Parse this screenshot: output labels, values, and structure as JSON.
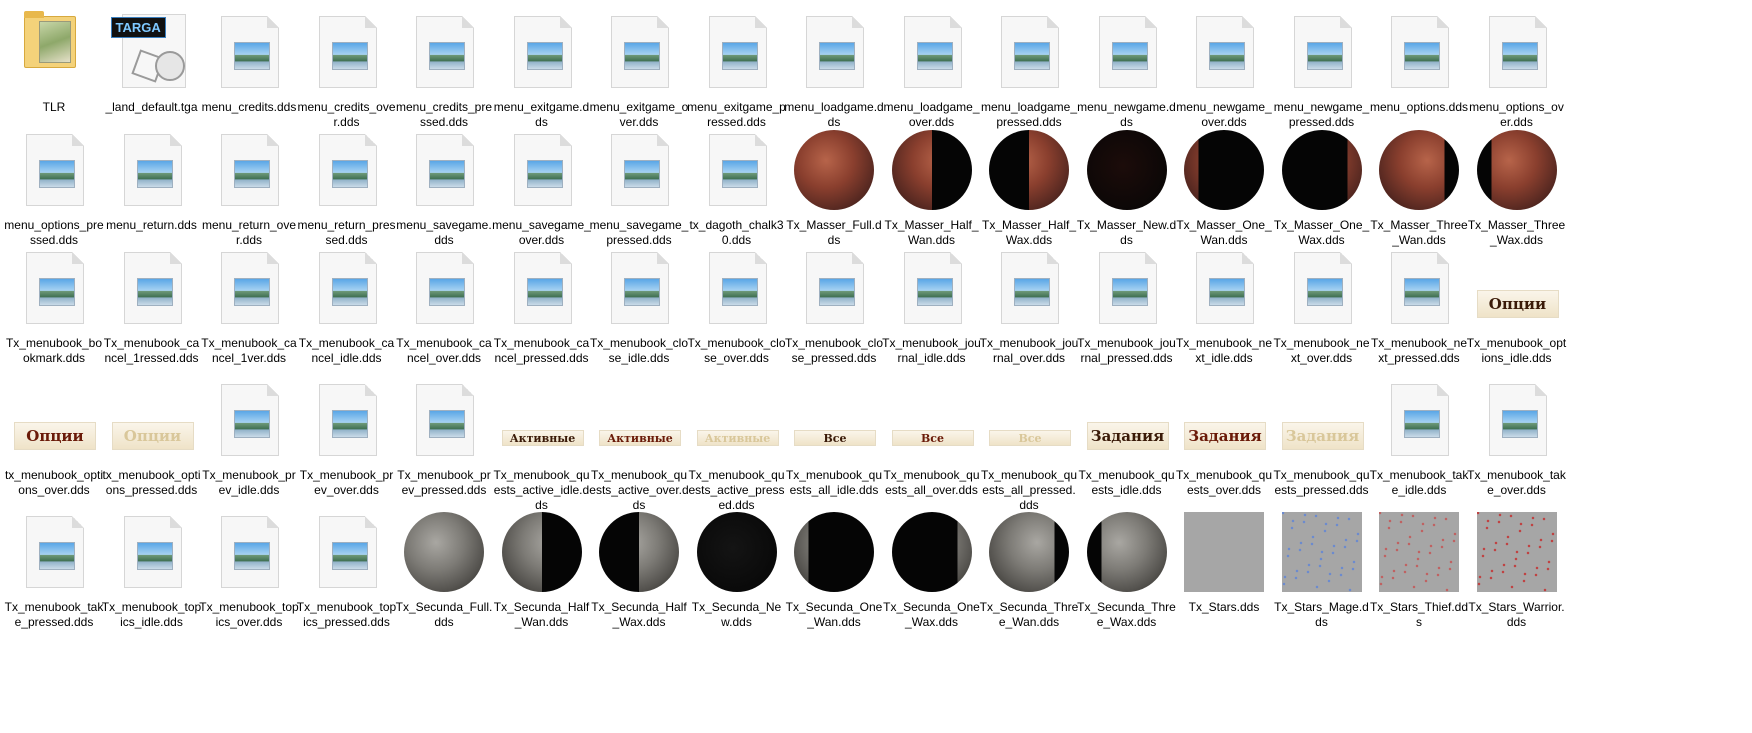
{
  "files": [
    {
      "label": "TLR",
      "kind": "folder"
    },
    {
      "label": "_land_default.tga",
      "kind": "tga",
      "badge": "TARGA"
    },
    {
      "label": "menu_credits.dds",
      "kind": "doc"
    },
    {
      "label": "menu_credits_over.dds",
      "kind": "doc"
    },
    {
      "label": "menu_credits_pressed.dds",
      "kind": "doc"
    },
    {
      "label": "menu_exitgame.dds",
      "kind": "doc"
    },
    {
      "label": "menu_exitgame_over.dds",
      "kind": "doc"
    },
    {
      "label": "menu_exitgame_pressed.dds",
      "kind": "doc"
    },
    {
      "label": "menu_loadgame.dds",
      "kind": "doc"
    },
    {
      "label": "menu_loadgame_over.dds",
      "kind": "doc"
    },
    {
      "label": "menu_loadgame_pressed.dds",
      "kind": "doc"
    },
    {
      "label": "menu_newgame.dds",
      "kind": "doc"
    },
    {
      "label": "menu_newgame_over.dds",
      "kind": "doc"
    },
    {
      "label": "menu_newgame_pressed.dds",
      "kind": "doc"
    },
    {
      "label": "menu_options.dds",
      "kind": "doc"
    },
    {
      "label": "menu_options_over.dds",
      "kind": "doc"
    },
    {
      "label": "menu_options_pressed.dds",
      "kind": "doc"
    },
    {
      "label": "menu_return.dds",
      "kind": "doc"
    },
    {
      "label": "menu_return_over.dds",
      "kind": "doc"
    },
    {
      "label": "menu_return_pressed.dds",
      "kind": "doc"
    },
    {
      "label": "menu_savegame.dds",
      "kind": "doc"
    },
    {
      "label": "menu_savegame_over.dds",
      "kind": "doc"
    },
    {
      "label": "menu_savegame_pressed.dds",
      "kind": "doc"
    },
    {
      "label": "tx_dagoth_chalk30.dds",
      "kind": "doc"
    },
    {
      "label": "Tx_Masser_Full.dds",
      "kind": "moon",
      "moon": "masser",
      "phase": "full"
    },
    {
      "label": "Tx_Masser_Half_Wan.dds",
      "kind": "moon",
      "moon": "masser",
      "phase": "half-wan"
    },
    {
      "label": "Tx_Masser_Half_Wax.dds",
      "kind": "moon",
      "moon": "masser",
      "phase": "half-wax"
    },
    {
      "label": "Tx_Masser_New.dds",
      "kind": "moon",
      "moon": "masser",
      "phase": "new"
    },
    {
      "label": "Tx_Masser_One_Wan.dds",
      "kind": "moon",
      "moon": "masser",
      "phase": "one-wan"
    },
    {
      "label": "Tx_Masser_One_Wax.dds",
      "kind": "moon",
      "moon": "masser",
      "phase": "one-wax"
    },
    {
      "label": "Tx_Masser_Three_Wan.dds",
      "kind": "moon",
      "moon": "masser",
      "phase": "three-wan"
    },
    {
      "label": "Tx_Masser_Three_Wax.dds",
      "kind": "moon",
      "moon": "masser",
      "phase": "three-wax"
    },
    {
      "label": "Tx_menubook_bookmark.dds",
      "kind": "doc"
    },
    {
      "label": "Tx_menubook_cancel_1ressed.dds",
      "kind": "doc"
    },
    {
      "label": "Tx_menubook_cancel_1ver.dds",
      "kind": "doc"
    },
    {
      "label": "Tx_menubook_cancel_idle.dds",
      "kind": "doc"
    },
    {
      "label": "Tx_menubook_cancel_over.dds",
      "kind": "doc"
    },
    {
      "label": "Tx_menubook_cancel_pressed.dds",
      "kind": "doc"
    },
    {
      "label": "Tx_menubook_close_idle.dds",
      "kind": "doc"
    },
    {
      "label": "Tx_menubook_close_over.dds",
      "kind": "doc"
    },
    {
      "label": "Tx_menubook_close_pressed.dds",
      "kind": "doc"
    },
    {
      "label": "Tx_menubook_journal_idle.dds",
      "kind": "doc"
    },
    {
      "label": "Tx_menubook_journal_over.dds",
      "kind": "doc"
    },
    {
      "label": "Tx_menubook_journal_pressed.dds",
      "kind": "doc"
    },
    {
      "label": "Tx_menubook_next_idle.dds",
      "kind": "doc"
    },
    {
      "label": "Tx_menubook_next_over.dds",
      "kind": "doc"
    },
    {
      "label": "Tx_menubook_next_pressed.dds",
      "kind": "doc"
    },
    {
      "label": "Tx_menubook_options_idle.dds",
      "kind": "btn",
      "text": "Опции",
      "color": "#3a1a08"
    },
    {
      "label": "tx_menubook_options_over.dds",
      "kind": "btn",
      "text": "Опции",
      "color": "#6a1a08"
    },
    {
      "label": "tx_menubook_options_pressed.dds",
      "kind": "btn",
      "text": "Опции",
      "color": "#d9c79a"
    },
    {
      "label": "Tx_menubook_prev_idle.dds",
      "kind": "doc"
    },
    {
      "label": "Tx_menubook_prev_over.dds",
      "kind": "doc"
    },
    {
      "label": "Tx_menubook_prev_pressed.dds",
      "kind": "doc"
    },
    {
      "label": "Tx_menubook_quests_active_idle.dds",
      "kind": "btnsmall",
      "text": "Активные",
      "color": "#3a1a08"
    },
    {
      "label": "Tx_menubook_quests_active_over.dds",
      "kind": "btnsmall",
      "text": "Активные",
      "color": "#6a1a08"
    },
    {
      "label": "Tx_menubook_quests_active_pressed.dds",
      "kind": "btnsmall",
      "text": "Активные",
      "color": "#d9c79a"
    },
    {
      "label": "Tx_menubook_quests_all_idle.dds",
      "kind": "btnsmall",
      "text": "Все",
      "color": "#3a1a08"
    },
    {
      "label": "Tx_menubook_quests_all_over.dds",
      "kind": "btnsmall",
      "text": "Все",
      "color": "#6a1a08"
    },
    {
      "label": "Tx_menubook_quests_all_pressed.dds",
      "kind": "btnsmall",
      "text": "Все",
      "color": "#d9c79a"
    },
    {
      "label": "Tx_menubook_quests_idle.dds",
      "kind": "btn",
      "text": "Задания",
      "color": "#3a1a08"
    },
    {
      "label": "Tx_menubook_quests_over.dds",
      "kind": "btn",
      "text": "Задания",
      "color": "#6a1a08"
    },
    {
      "label": "Tx_menubook_quests_pressed.dds",
      "kind": "btn",
      "text": "Задания",
      "color": "#d9c79a"
    },
    {
      "label": "Tx_menubook_take_idle.dds",
      "kind": "doc"
    },
    {
      "label": "Tx_menubook_take_over.dds",
      "kind": "doc"
    },
    {
      "label": "Tx_menubook_take_pressed.dds",
      "kind": "doc"
    },
    {
      "label": "Tx_menubook_topics_idle.dds",
      "kind": "doc"
    },
    {
      "label": "Tx_menubook_topics_over.dds",
      "kind": "doc"
    },
    {
      "label": "Tx_menubook_topics_pressed.dds",
      "kind": "doc"
    },
    {
      "label": "Tx_Secunda_Full.dds",
      "kind": "moon",
      "moon": "secunda",
      "phase": "full"
    },
    {
      "label": "Tx_Secunda_Half_Wan.dds",
      "kind": "moon",
      "moon": "secunda",
      "phase": "half-wan"
    },
    {
      "label": "Tx_Secunda_Half_Wax.dds",
      "kind": "moon",
      "moon": "secunda",
      "phase": "half-wax"
    },
    {
      "label": "Tx_Secunda_New.dds",
      "kind": "moon",
      "moon": "secunda",
      "phase": "new"
    },
    {
      "label": "Tx_Secunda_One_Wan.dds",
      "kind": "moon",
      "moon": "secunda",
      "phase": "one-wan"
    },
    {
      "label": "Tx_Secunda_One_Wax.dds",
      "kind": "moon",
      "moon": "secunda",
      "phase": "one-wax"
    },
    {
      "label": "Tx_Secunda_Three_Wan.dds",
      "kind": "moon",
      "moon": "secunda",
      "phase": "three-wan"
    },
    {
      "label": "Tx_Secunda_Three_Wax.dds",
      "kind": "moon",
      "moon": "secunda",
      "phase": "three-wax"
    },
    {
      "label": "Tx_Stars.dds",
      "kind": "stars",
      "tint": "none"
    },
    {
      "label": "Tx_Stars_Mage.dds",
      "kind": "stars",
      "tint": "#6a8acf"
    },
    {
      "label": "Tx_Stars_Thief.dds",
      "kind": "stars",
      "tint": "#c06060"
    },
    {
      "label": "Tx_Stars_Warrior.dds",
      "kind": "stars",
      "tint": "#c04040"
    }
  ]
}
